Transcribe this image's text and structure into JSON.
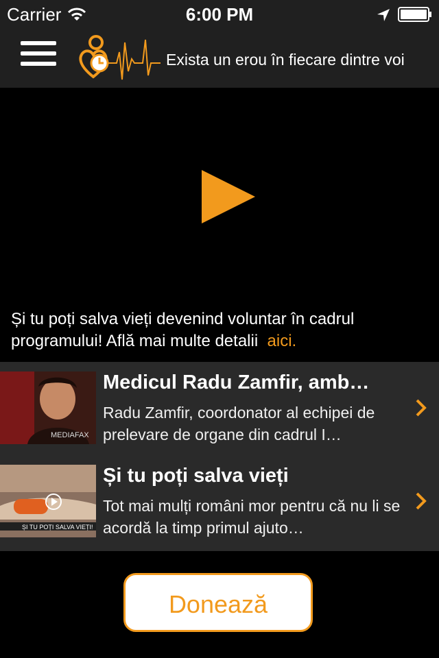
{
  "status_bar": {
    "carrier": "Carrier",
    "time": "6:00 PM",
    "icons": [
      "wifi-icon",
      "location-arrow-icon",
      "battery-icon"
    ]
  },
  "navbar": {
    "menu_icon": "hamburger-menu-icon",
    "logo_icon": "heart-pulse-logo-icon",
    "tagline": "Exista un erou în fiecare dintre voi"
  },
  "video": {
    "play_icon": "play-icon"
  },
  "promo": {
    "text": "Și tu poți salva vieți devenind voluntar în cadrul programului! Află mai multe detalii",
    "link_label": "aici."
  },
  "articles": [
    {
      "title": "Medicul Radu Zamfir, amb…",
      "description": "Radu Zamfir, coordonator al echipei de prelevare de organe din cadrul I…",
      "thumb_caption": "MEDIAFAX"
    },
    {
      "title": "Și tu poți salva vieți",
      "description": "Tot mai mulți români mor pentru că nu li se acordă la timp primul ajuto…",
      "thumb_caption": "ȘI TU POȚI SALVA VIEȚI!"
    }
  ],
  "donate_label": "Donează",
  "colors": {
    "accent": "#f29a1d",
    "bar_background": "#202020",
    "list_background": "#2a2a2a"
  }
}
